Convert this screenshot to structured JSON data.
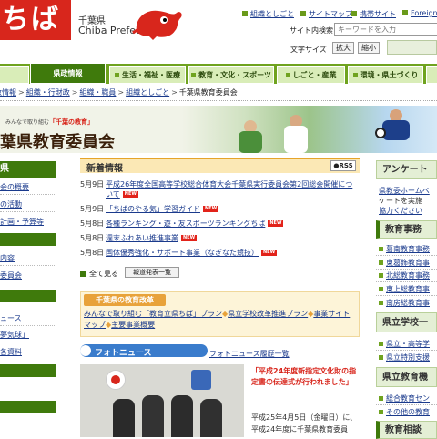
{
  "header": {
    "logo_text": "ちば",
    "pref_name": "千葉県",
    "pref_name_en": "Chiba Prefecture",
    "links": [
      "組織としごと",
      "サイトマップ",
      "携帯サイト",
      "Foreign"
    ],
    "search_label": "サイト内検索",
    "search_placeholder": "キーワードを入力",
    "fontsize_label": "文字サイズ",
    "fontsize_large": "拡大",
    "fontsize_small": "縮小"
  },
  "nav": {
    "tabs": [
      "県政情報",
      "生活・福祉・医療",
      "教育・文化・スポーツ",
      "しごと・産業",
      "環境・県土づくり"
    ]
  },
  "breadcrumb": [
    "県政情報",
    "組織・行財政",
    "組織・職員",
    "組織としごと",
    "千葉県教育委員会"
  ],
  "banner": {
    "tagline_prefix": "みんなで取り組む",
    "tagline_highlight": "「千葉の教育」",
    "title": "千葉県教育委員会"
  },
  "left": {
    "head1": "県",
    "items1": [
      "会の概要",
      "の活動",
      "計画・予算等"
    ],
    "items2": [
      "内容",
      "委員会"
    ],
    "items3": [
      "ュース",
      "夢気球」",
      "各資料"
    ]
  },
  "news": {
    "title": "新着情報",
    "rss": "RSS",
    "items": [
      {
        "date": "5月9日",
        "text": "平成26年度全国高等学校総合体育大会千葉県実行委員会第2回総会開催について",
        "new": true
      },
      {
        "date": "5月9日",
        "text": "「ちばのやる気」学習ガイド",
        "new": true
      },
      {
        "date": "5月8日",
        "text": "各種ランキング・遊・友スポーツランキングちば",
        "new": true
      },
      {
        "date": "5月8日",
        "text": "週末ふれあい推進事業",
        "new": true
      },
      {
        "date": "5月8日",
        "text": "国体優秀強化・サポート事業（なぎなた競技）",
        "new": true
      }
    ],
    "new_label": "NEW",
    "see_all": "全て見る",
    "press_button": "報道発表一覧"
  },
  "reform": {
    "title": "千葉県の教育改革",
    "link1": "みんなで取り組む「教育立県ちば」プラン",
    "link2": "県立学校改革推進プラン",
    "link3": "事業サイトマップ",
    "link4": "主要事業概要"
  },
  "photo_news": {
    "title": "フォトニュース",
    "archive": "フォトニュース履歴一覧",
    "caption": "「平成24年度新指定文化財の指定書の伝達式が行われました」",
    "text": "平成25年4月5日（金曜日）に、平成24年度に千葉県教育委員"
  },
  "right": {
    "survey": "アンケート",
    "survey_items": [
      "県教委ホームペ",
      "ケートを実施",
      "協力ください"
    ],
    "office_head": "教育事務",
    "office_items": [
      "葛南教育事務",
      "東葛飾教育事",
      "北総教育事務",
      "東上総教育事",
      "南房総教育事"
    ],
    "school_head": "県立学校一",
    "school_items": [
      "県立・高等学",
      "県立特別支援"
    ],
    "inst_head": "県立教育機",
    "inst_items": [
      "総合教育セン",
      "その他の教育"
    ],
    "support_head": "教育相談"
  },
  "colors": {
    "brand_red": "#d8261c",
    "nav_green": "#6fa31f",
    "dark_green": "#3f7a0c",
    "news_orange": "#e6a42a",
    "photo_blue": "#3a7ccc"
  }
}
